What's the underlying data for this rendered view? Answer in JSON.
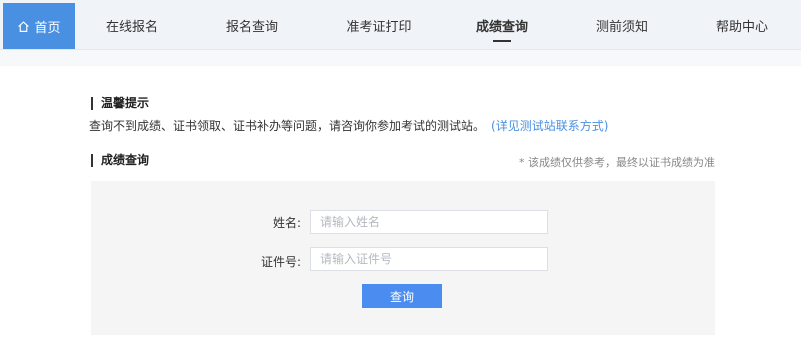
{
  "nav": {
    "home_label": "首页",
    "items": [
      {
        "label": "在线报名"
      },
      {
        "label": "报名查询"
      },
      {
        "label": "准考证打印"
      },
      {
        "label": "成绩查询"
      },
      {
        "label": "测前须知"
      },
      {
        "label": "帮助中心"
      }
    ],
    "active": "成绩查询"
  },
  "tips": {
    "title": "温馨提示",
    "text": "查询不到成绩、证书领取、证书补办等问题，请咨询你参加考试的测试站。",
    "link": "(详见测试站联系方式)"
  },
  "query": {
    "title": "成绩查询",
    "note": "* 该成绩仅供参考，最终以证书成绩为准",
    "name_label": "姓名:",
    "name_placeholder": "请输入姓名",
    "cert_label": "证件号:",
    "cert_placeholder": "请输入证件号",
    "submit_label": "查询"
  },
  "colors": {
    "accent": "#4a8cf0",
    "home_bg": "#4a90e2",
    "link": "#4a90e2"
  }
}
